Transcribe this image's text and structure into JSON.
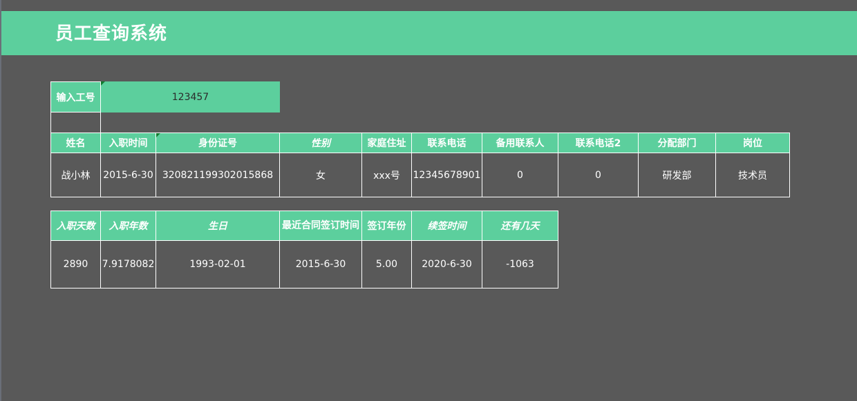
{
  "app": {
    "title": "员工查询系统"
  },
  "lookup": {
    "label": "输入工号",
    "value": "123457"
  },
  "table1": {
    "headers": [
      "姓名",
      "入职时间",
      "身份证号",
      "性别",
      "家庭住址",
      "联系电话",
      "备用联系人",
      "联系电话2",
      "分配部门",
      "岗位"
    ],
    "row": [
      "战小林",
      "2015-6-30",
      "320821199302015868",
      "女",
      "xxx号",
      "12345678901",
      "0",
      "0",
      "研发部",
      "技术员"
    ]
  },
  "table2": {
    "headers": [
      "入职天数",
      "入职年数",
      "生日",
      "最近合同签订时间",
      "签订年份",
      "续签时间",
      "还有几天"
    ],
    "row": [
      "2890",
      "7.9178082",
      "1993-02-01",
      "2015-6-30",
      "5.00",
      "2020-6-30",
      "-1063"
    ]
  },
  "colors": {
    "background": "#595959",
    "accent": "#5ccf9d",
    "text": "#ffffff"
  }
}
